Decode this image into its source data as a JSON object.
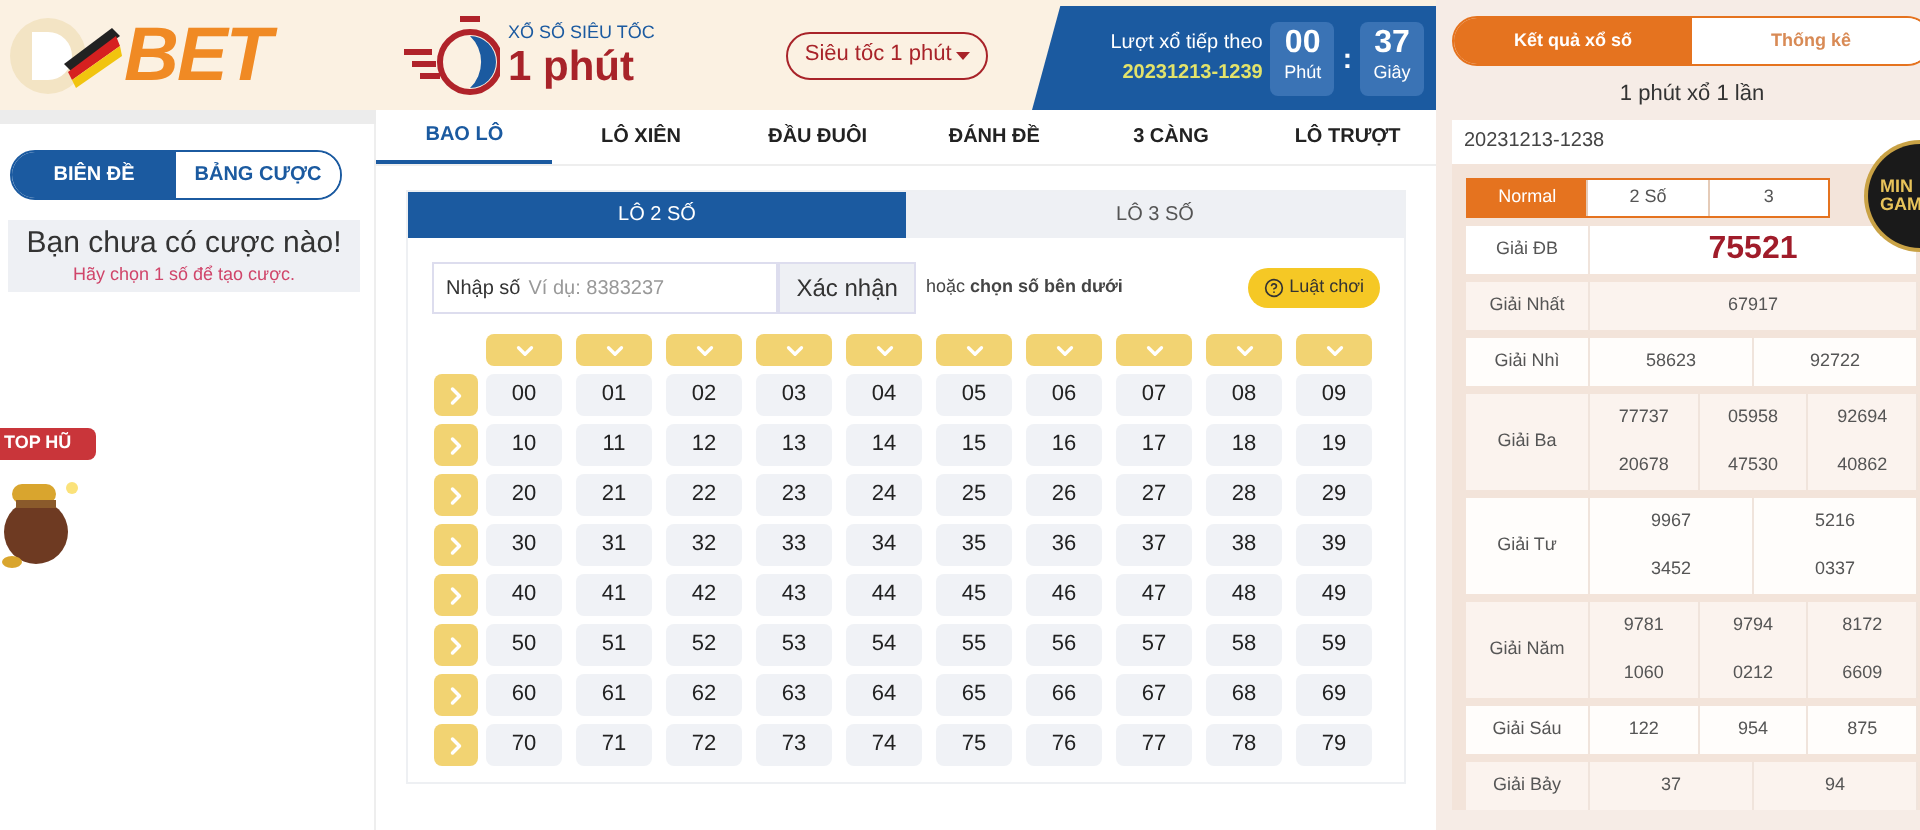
{
  "logo": {
    "text": "BET"
  },
  "sidebar": {
    "tabs": [
      {
        "label": "BIÊN ĐỀ",
        "selected": true
      },
      {
        "label": "BẢNG CƯỢC",
        "selected": false
      }
    ],
    "empty_title": "Bạn chưa có cược nào!",
    "empty_hint": "Hãy chọn 1 số để tạo cược.",
    "jackpot_badge": "TOP HŨ"
  },
  "game": {
    "subtitle": "XỔ SỐ SIÊU TỐC",
    "title": "1 phút",
    "mode_dropdown": "Siêu tốc 1 phút",
    "next_label": "Lượt xổ tiếp theo",
    "next_draw": "20231213-1239",
    "timer": [
      {
        "value": "00",
        "unit": "Phút"
      },
      {
        "value": "37",
        "unit": "Giây"
      }
    ],
    "timer_separator": ":"
  },
  "tabs": [
    {
      "label": "BAO LÔ",
      "selected": true
    },
    {
      "label": "LÔ XIÊN",
      "selected": false
    },
    {
      "label": "ĐẦU ĐUÔI",
      "selected": false
    },
    {
      "label": "ĐÁNH ĐỀ",
      "selected": false
    },
    {
      "label": "3 CÀNG",
      "selected": false
    },
    {
      "label": "LÔ TRƯỢT",
      "selected": false
    }
  ],
  "subtabs": [
    {
      "label": "LÔ 2 SỐ",
      "selected": true
    },
    {
      "label": "LÔ 3 SỐ",
      "selected": false
    }
  ],
  "entry": {
    "label": "Nhập số",
    "placeholder": "Ví dụ: 8383237",
    "confirm": "Xác nhận",
    "hint": "hoặc **chọn số bên dưới**",
    "rules": "Luật chơi"
  },
  "number_rows": [
    [
      "00",
      "01",
      "02",
      "03",
      "04",
      "05",
      "06",
      "07",
      "08",
      "09"
    ],
    [
      "10",
      "11",
      "12",
      "13",
      "14",
      "15",
      "16",
      "17",
      "18",
      "19"
    ],
    [
      "20",
      "21",
      "22",
      "23",
      "24",
      "25",
      "26",
      "27",
      "28",
      "29"
    ],
    [
      "30",
      "31",
      "32",
      "33",
      "34",
      "35",
      "36",
      "37",
      "38",
      "39"
    ],
    [
      "40",
      "41",
      "42",
      "43",
      "44",
      "45",
      "46",
      "47",
      "48",
      "49"
    ],
    [
      "50",
      "51",
      "52",
      "53",
      "54",
      "55",
      "56",
      "57",
      "58",
      "59"
    ],
    [
      "60",
      "61",
      "62",
      "63",
      "64",
      "65",
      "66",
      "67",
      "68",
      "69"
    ],
    [
      "70",
      "71",
      "72",
      "73",
      "74",
      "75",
      "76",
      "77",
      "78",
      "79"
    ]
  ],
  "results": {
    "tabs": [
      {
        "label": "Kết quả xổ số",
        "selected": true
      },
      {
        "label": "Thống kê",
        "selected": false
      }
    ],
    "frequency": "1 phút xổ 1 lần",
    "draw_id": "20231213-1238",
    "modes": [
      {
        "label": "Normal",
        "selected": true
      },
      {
        "label": "2 Số",
        "selected": false
      },
      {
        "label": "3",
        "selected": false
      }
    ],
    "prizes": [
      {
        "label": "Giải ĐB",
        "highlight": true,
        "rows": [
          [
            "75521"
          ]
        ]
      },
      {
        "label": "Giải Nhất",
        "highlight": false,
        "rows": [
          [
            "67917"
          ]
        ]
      },
      {
        "label": "Giải Nhì",
        "highlight": false,
        "rows": [
          [
            "58623",
            "92722"
          ]
        ]
      },
      {
        "label": "Giải Ba",
        "highlight": false,
        "rows": [
          [
            "77737",
            "05958",
            "92694"
          ],
          [
            "20678",
            "47530",
            "40862"
          ]
        ]
      },
      {
        "label": "Giải Tư",
        "highlight": false,
        "rows": [
          [
            "9967",
            "5216"
          ],
          [
            "3452",
            "0337"
          ]
        ]
      },
      {
        "label": "Giải Năm",
        "highlight": false,
        "rows": [
          [
            "9781",
            "9794",
            "8172"
          ],
          [
            "1060",
            "0212",
            "6609"
          ]
        ]
      },
      {
        "label": "Giải Sáu",
        "highlight": false,
        "rows": [
          [
            "122",
            "954",
            "875"
          ]
        ]
      },
      {
        "label": "Giải Bảy",
        "highlight": false,
        "rows": [
          [
            "37",
            "94"
          ]
        ]
      }
    ]
  },
  "mini_game": {
    "line1": "MIN",
    "line2": "GAM"
  }
}
